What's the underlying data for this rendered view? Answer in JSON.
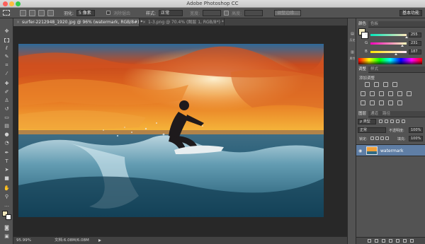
{
  "app": {
    "title": "Adobe Photoshop CC"
  },
  "options_bar": {
    "feather_label": "羽化:",
    "feather_value": "5 像素",
    "antialias_label": "消除锯齿",
    "style_label": "样式:",
    "style_value": "正常",
    "width_label": "宽度:",
    "height_label": "高度:",
    "refine_edge_label": "调整边缘...",
    "workspace": "基本功能"
  },
  "tabs": [
    {
      "label": "surfer-2212948_1920.jpg @ 96% (watermark, RGB/8#) *",
      "active": true
    },
    {
      "label": "1-3.png @ 70.4% (图层 1, RGB/8*) *",
      "active": false
    }
  ],
  "status": {
    "zoom": "95.99%",
    "doc": "文档:6.08M/6.08M"
  },
  "panel_strip": {
    "history_label": "历史",
    "properties_label": "属性"
  },
  "color_panel": {
    "tabs": [
      "颜色",
      "色板"
    ],
    "r_label": "R",
    "r_value": "255",
    "r_level": 1.0,
    "g_label": "G",
    "g_value": "231",
    "g_level": 0.906,
    "b_label": "B",
    "b_value": "187",
    "b_level": 0.733,
    "foreground": "#ffe7bb",
    "background": "#ffffff"
  },
  "adjustments_panel": {
    "tabs": [
      "调整",
      "样式"
    ],
    "title": "添加调整"
  },
  "layers_panel": {
    "tabs": [
      "图层",
      "通道",
      "路径"
    ],
    "kind_label": "ρ 类型",
    "blend_mode": "正常",
    "opacity_label": "不透明度:",
    "opacity_value": "100%",
    "lock_label": "锁定:",
    "fill_label": "填充:",
    "fill_value": "100%",
    "layers": [
      {
        "name": "watermark",
        "visible": true
      }
    ]
  },
  "colors": {
    "app_bg": "#535353",
    "canvas_bg": "#282828",
    "layer_selected": "#5f7ea5"
  }
}
